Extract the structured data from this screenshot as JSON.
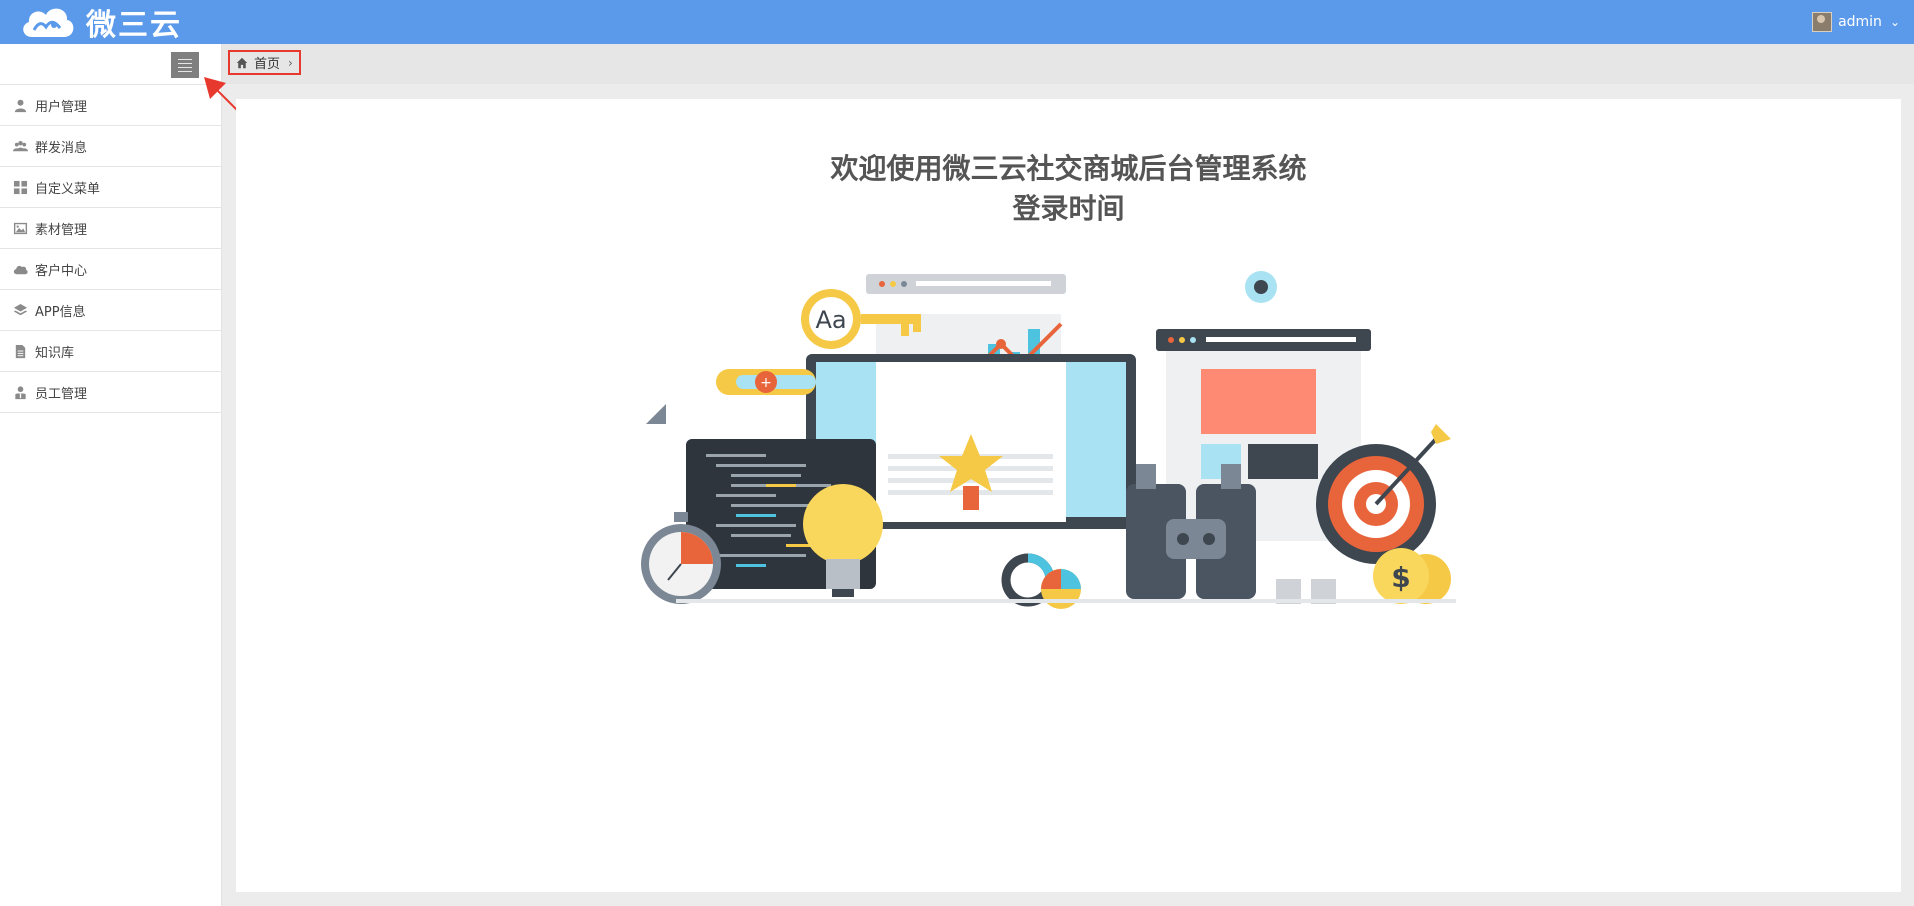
{
  "header": {
    "brand": "微三云",
    "username": "admin"
  },
  "sidebar": {
    "items": [
      {
        "label": "用户管理",
        "icon": "user-icon"
      },
      {
        "label": "群发消息",
        "icon": "users-icon"
      },
      {
        "label": "自定义菜单",
        "icon": "grid-icon"
      },
      {
        "label": "素材管理",
        "icon": "image-icon"
      },
      {
        "label": "客户中心",
        "icon": "cloud-icon"
      },
      {
        "label": "APP信息",
        "icon": "layers-icon"
      },
      {
        "label": "知识库",
        "icon": "document-icon"
      },
      {
        "label": "员工管理",
        "icon": "staff-icon"
      }
    ]
  },
  "breadcrumb": {
    "home": "首页"
  },
  "main": {
    "welcome_line1": "欢迎使用微三云社交商城后台管理系统",
    "welcome_line2": "登录时间"
  },
  "colors": {
    "topbar": "#5b9aea",
    "annotation": "#e8392f"
  }
}
